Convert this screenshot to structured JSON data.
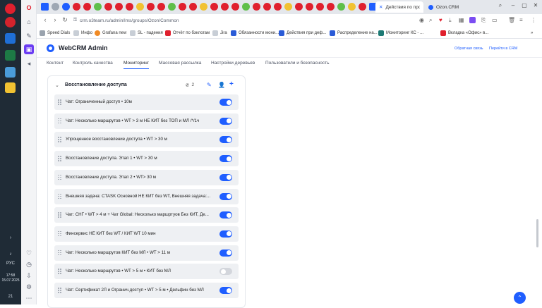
{
  "taskbar": {
    "language": "РУС",
    "time": "17:58",
    "date": "15.07.2025",
    "notifications": "21"
  },
  "browser": {
    "tabs": [
      {
        "title": "Действия по проект"
      },
      {
        "title": "Ozon.CRM"
      }
    ],
    "url": "crm.o3team.ru/admin/lms/groups/Ozon/Common",
    "bookmarks": [
      "Speed Dials",
      "Инфо",
      "Grafana new",
      "SL - падения",
      "Отчёт по бэклогам",
      "Jira",
      "Обязанности мони...",
      "Действия при деф...",
      "Распределение на...",
      "Мониторинг КС - ...",
      "Вкладка «Офис» в..."
    ]
  },
  "app": {
    "title": "WebCRM Admin",
    "header_links": {
      "feedback": "Обратная связь",
      "go_to_crm": "Перейти в CRM"
    },
    "nav_tabs": [
      "Контент",
      "Контроль качества",
      "Мониторинг",
      "Массовая рассылка",
      "Настройки деревьев",
      "Пользователи и безопасность"
    ],
    "active_tab": "Мониторинг",
    "group": {
      "title": "Восстановление доступа",
      "count": "2",
      "items": [
        {
          "label": "Чат: Ограниченный доступ • 10м",
          "enabled": true
        },
        {
          "label": "Чат: Несколько маршрутов • WT > 3 м НЕ КИТ без ТОП и МЛ /*/1ч",
          "enabled": true
        },
        {
          "label": "Упрощенное восстановление доступа • WT > 30 м",
          "enabled": true
        },
        {
          "label": "Восстановление доступа. Этап 1 • WT > 30 м",
          "enabled": true
        },
        {
          "label": "Восстановление доступа. Этап 2 • WT> 30 м",
          "enabled": true
        },
        {
          "label": "Внешняя задача: CTASK Основной НЕ КИТ без WT, Внешняя задача:...",
          "enabled": true
        },
        {
          "label": "Чат: СНГ • WT > 4 м + Чат Global: Несколько маршртуов Без КИТ, Де...",
          "enabled": true
        },
        {
          "label": "Финсервис НЕ КИТ без WT / КИТ WT 10 мин",
          "enabled": true
        },
        {
          "label": "Чат: Несколько маршрутов КИТ без МЛ • WT > 11 м",
          "enabled": true
        },
        {
          "label": "Чат: Несколько маршрутов • WT > 5 м • КИТ без МЛ",
          "enabled": false
        },
        {
          "label": "Чат: Сертификат 2Л и Огранич.доступ • WT > 5 м • Дельфин без МЛ",
          "enabled": true
        }
      ]
    }
  },
  "colors": {
    "accent": "#1f5eff",
    "taskbar": "#1f2b36",
    "row_bg": "#eef0f3",
    "toggle_off": "#d3d6dc"
  },
  "icons": [
    "opera-icon",
    "search-icon",
    "phone-icon",
    "pencil-icon",
    "user-icon",
    "plus-icon",
    "chevron-down-icon",
    "arrow-up-icon"
  ]
}
